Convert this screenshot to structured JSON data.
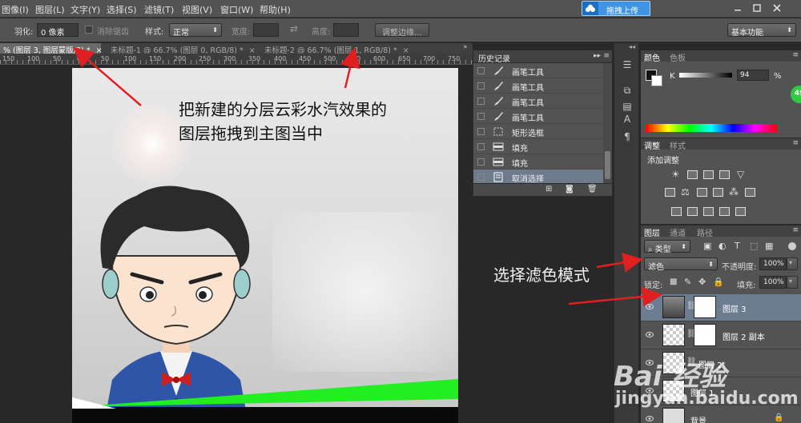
{
  "menu": [
    "图像(I)",
    "图层(L)",
    "文字(Y)",
    "选择(S)",
    "滤镜(T)",
    "视图(V)",
    "窗口(W)",
    "帮助(H)"
  ],
  "upload_button": "拖拽上传",
  "window_controls": [
    "minimize-icon",
    "restore-icon",
    "close-icon"
  ],
  "options": {
    "feather_label": "羽化:",
    "feather_value": "0 像素",
    "antialias_label": "消除锯齿",
    "style_label": "样式:",
    "style_value": "正常",
    "width_label": "宽度:",
    "height_label": "高度:",
    "refine_edge_button": "调整边缘...",
    "workspace_value": "基本功能"
  },
  "tabs": [
    {
      "label": "% (图层 3, 图层蒙版/8) *",
      "active": true
    },
    {
      "label": "未标题-1 @ 66.7% (图层 0, RGB/8) *",
      "active": false
    },
    {
      "label": "未标题-2 @ 66.7% (图层 1, RGB/8) *",
      "active": false
    }
  ],
  "ruler_ticks": [
    "150",
    "100",
    "50",
    "0",
    "50",
    "100",
    "150",
    "200",
    "250",
    "300",
    "350",
    "400",
    "450",
    "500",
    "550",
    "600",
    "650",
    "700",
    "750"
  ],
  "annotations": {
    "canvas_note_line1": "把新建的分层云彩水汽效果的",
    "canvas_note_line2": "图层拖拽到主图当中",
    "blend_note": "选择滤色模式"
  },
  "history": {
    "title": "历史记录",
    "items": [
      {
        "label": "画笔工具",
        "icon": "brush-icon"
      },
      {
        "label": "画笔工具",
        "icon": "brush-icon"
      },
      {
        "label": "画笔工具",
        "icon": "brush-icon"
      },
      {
        "label": "画笔工具",
        "icon": "brush-icon"
      },
      {
        "label": "矩形选框",
        "icon": "marquee-icon"
      },
      {
        "label": "填充",
        "icon": "fill-icon"
      },
      {
        "label": "填充",
        "icon": "fill-icon"
      },
      {
        "label": "取消选择",
        "icon": "history-step-icon"
      }
    ],
    "active_index": 7
  },
  "color_panel": {
    "tabs": [
      "颜色",
      "色板"
    ],
    "channel_label": "K",
    "channel_value": "94",
    "unit": "%"
  },
  "adjustments_panel": {
    "tabs": [
      "调整",
      "样式"
    ],
    "title": "添加调整"
  },
  "layers_panel": {
    "tabs": [
      "图层",
      "通道",
      "路径"
    ],
    "filter_kind": "类型",
    "blend_mode": "滤色",
    "opacity_label": "不透明度:",
    "opacity_value": "100%",
    "lock_label": "锁定:",
    "fill_label": "填充:",
    "fill_value": "100%",
    "layers": [
      {
        "name": "图层 3",
        "selected": true
      },
      {
        "name": "图层 2 副本",
        "selected": false
      },
      {
        "name": "图层 2",
        "selected": false
      },
      {
        "name": "图层 1",
        "selected": false
      },
      {
        "name": "背景",
        "selected": false
      }
    ]
  },
  "badge": "49",
  "watermark": {
    "logo": "Bai 经验",
    "url": "jingyan.baidu.com"
  },
  "colors": {
    "panel_bg": "#535353",
    "workspace_bg": "#282828",
    "selection_blue": "#6c7c91",
    "arrow_red": "#e02020",
    "green_strip": "#22ee22",
    "accent_button": "#3f95e4"
  }
}
